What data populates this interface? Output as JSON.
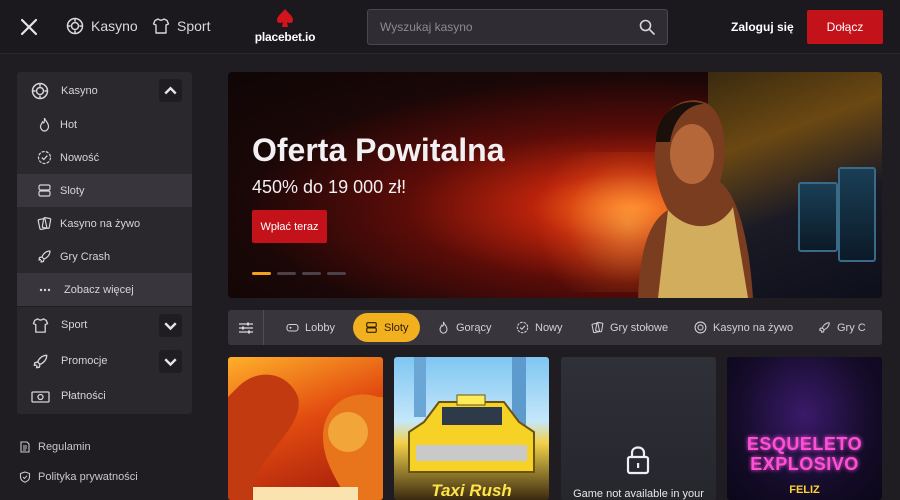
{
  "header": {
    "nav": [
      {
        "label": "Kasyno",
        "icon": "casino-chip-icon"
      },
      {
        "label": "Sport",
        "icon": "jersey-icon"
      }
    ],
    "logo_text": "placebet.io",
    "search_placeholder": "Wyszukaj kasyno",
    "login_label": "Zaloguj się",
    "join_label": "Dołącz"
  },
  "sidebar": {
    "casino": {
      "label": "Kasyno",
      "icon": "casino-chip-icon",
      "expanded": true
    },
    "casino_items": [
      {
        "label": "Hot",
        "icon": "flame-icon"
      },
      {
        "label": "Nowość",
        "icon": "check-badge-icon"
      },
      {
        "label": "Sloty",
        "icon": "slots-icon",
        "active": true
      },
      {
        "label": "Kasyno na żywo",
        "icon": "live-cards-icon"
      },
      {
        "label": "Gry Crash",
        "icon": "rocket-icon"
      },
      {
        "label": "Zobacz więcej",
        "icon": "more-dots-icon"
      }
    ],
    "sport": {
      "label": "Sport",
      "icon": "jersey-icon"
    },
    "promos": {
      "label": "Promocje",
      "icon": "rocket-icon"
    },
    "payments": {
      "label": "Płatności",
      "icon": "banknote-icon"
    },
    "footer": [
      {
        "label": "Regulamin",
        "icon": "document-icon"
      },
      {
        "label": "Polityka prywatności",
        "icon": "shield-icon"
      }
    ]
  },
  "banner": {
    "title": "Oferta Powitalna",
    "subtitle": "450% do 19 000 zł!",
    "cta_label": "Wpłać teraz",
    "slide_count": 4,
    "active_slide": 1
  },
  "tabs": [
    {
      "label": "Lobby",
      "icon": "gamepad-icon"
    },
    {
      "label": "Sloty",
      "icon": "slots-icon",
      "active": true
    },
    {
      "label": "Gorący",
      "icon": "flame-icon"
    },
    {
      "label": "Nowy",
      "icon": "check-badge-icon"
    },
    {
      "label": "Gry stołowe",
      "icon": "table-cards-icon"
    },
    {
      "label": "Kasyno na żywo",
      "icon": "casino-chip-icon"
    },
    {
      "label": "Gry C",
      "icon": "rocket-icon"
    }
  ],
  "games": [
    {
      "title": "",
      "theme": "dragon-tiger"
    },
    {
      "title": "Taxi Rush",
      "badge": "TAXI"
    },
    {
      "title": "",
      "unavailable_text": "Game not available in your"
    },
    {
      "title": "ESQUELETO EXPLOSIVO",
      "tagline": "FELIZ"
    }
  ],
  "colors": {
    "accent_red": "#c4121a",
    "accent_yellow": "#f2b01e",
    "bg": "#1f1d21",
    "panel": "#2a282d"
  }
}
